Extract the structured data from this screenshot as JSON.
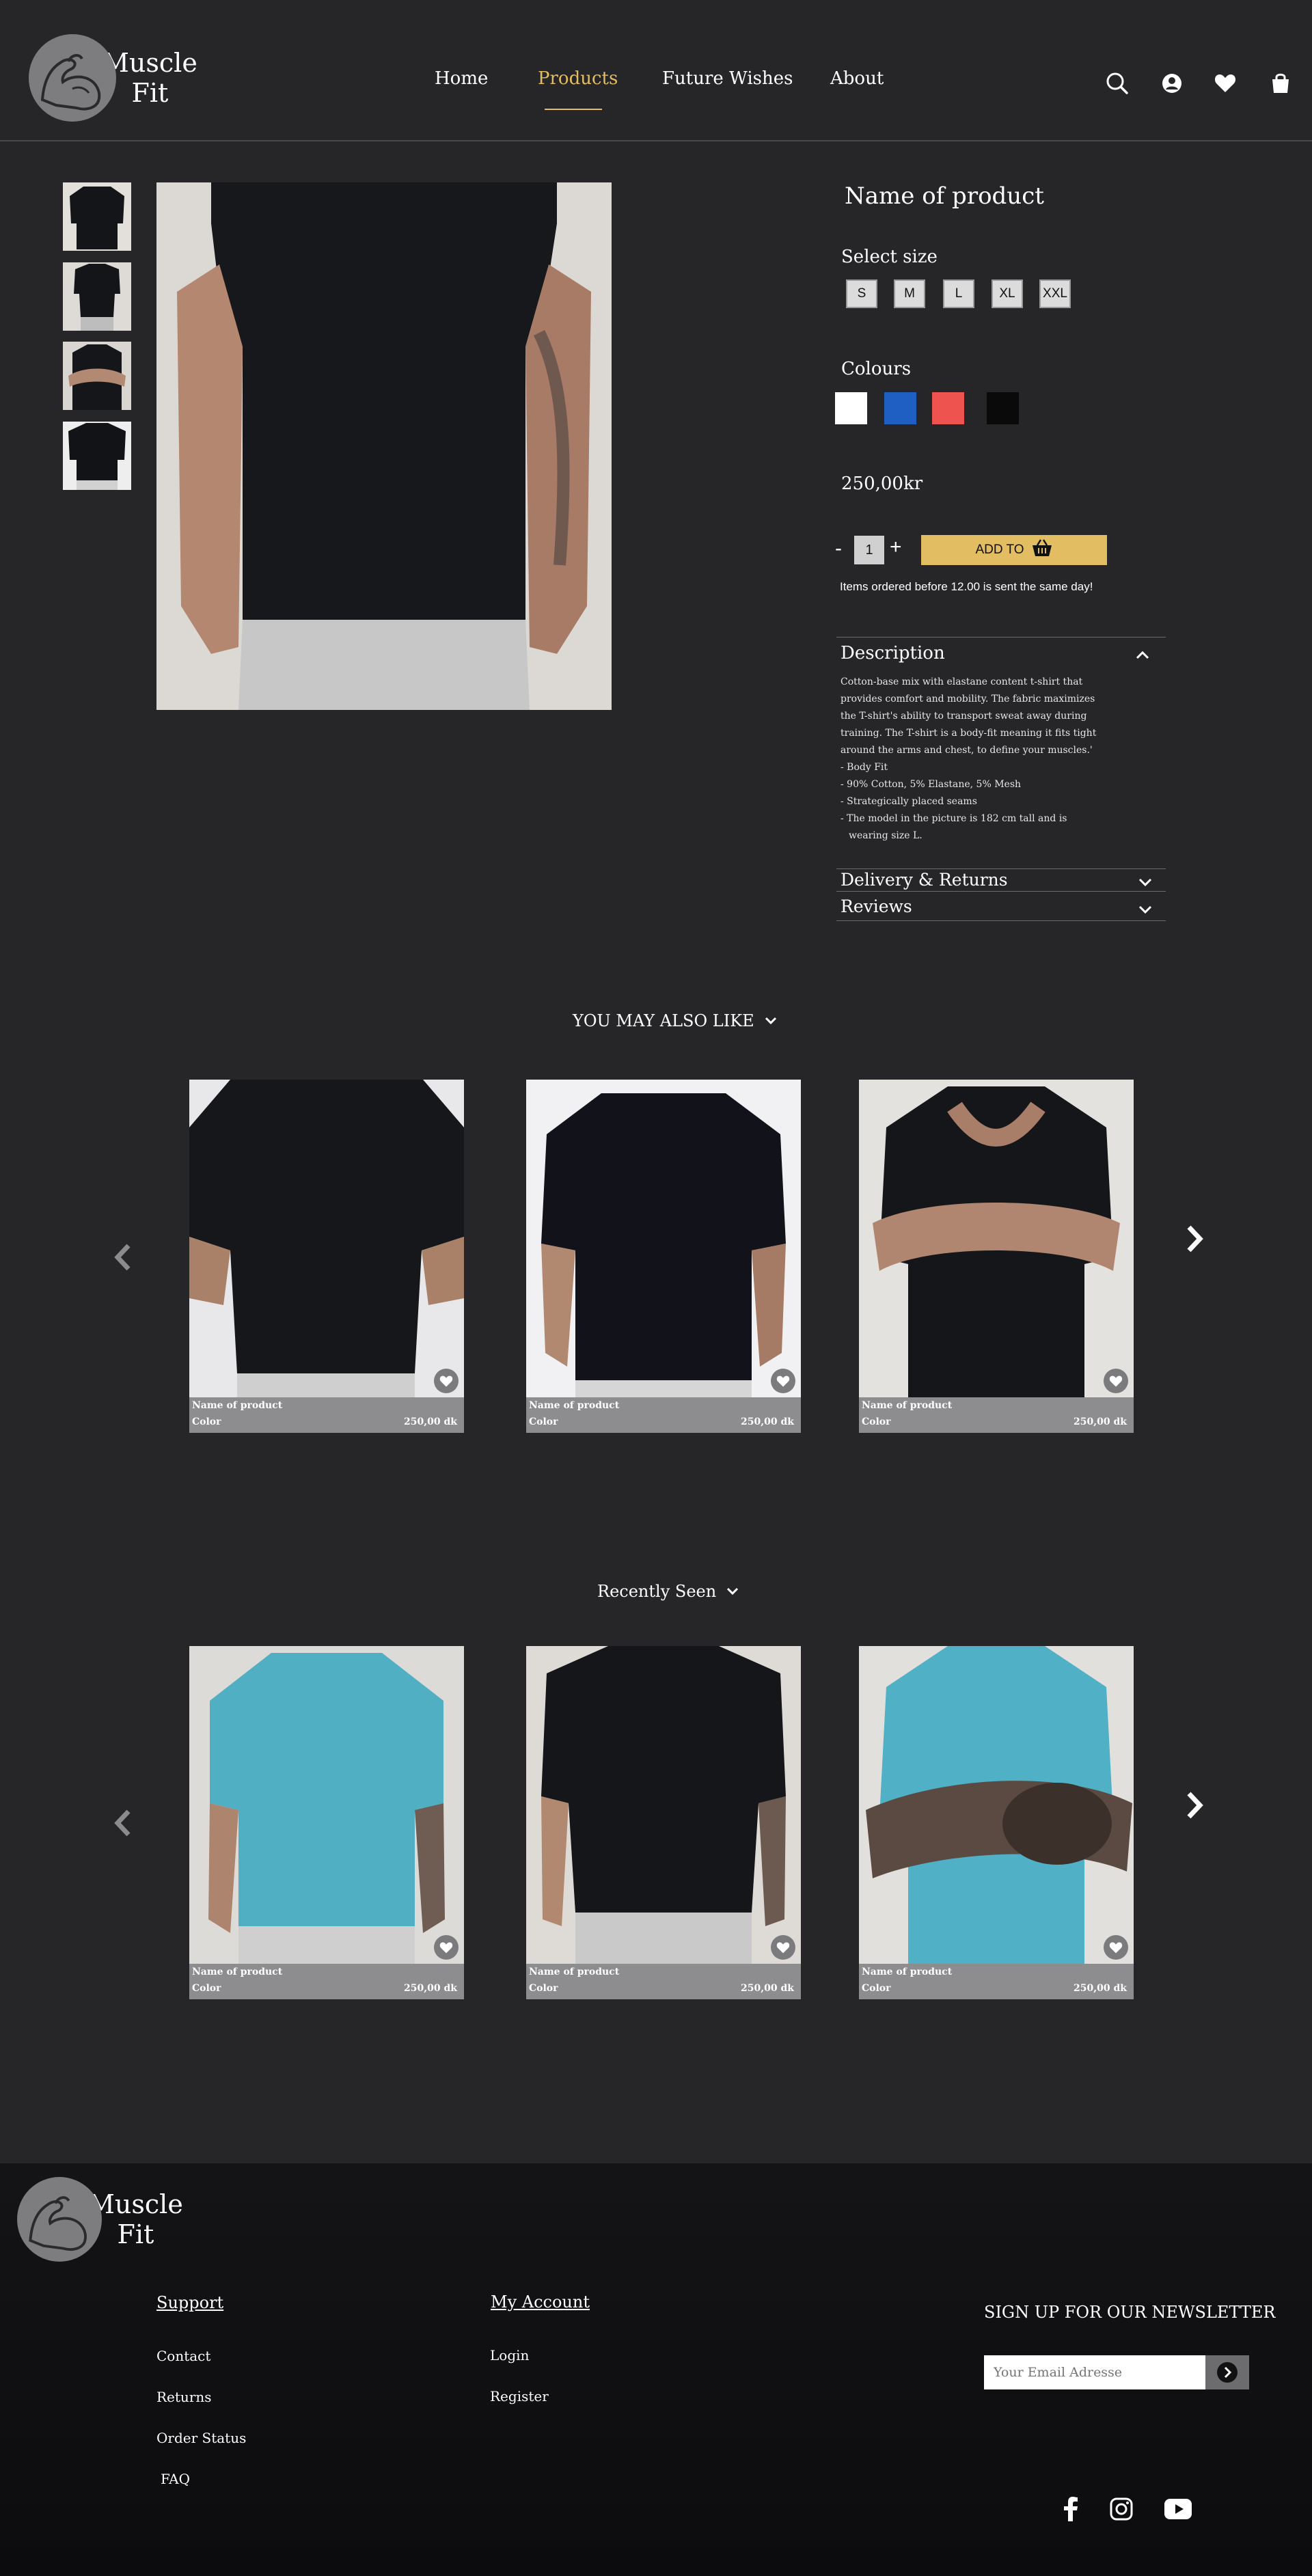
{
  "brand": {
    "line1": "Muscle",
    "line2": "Fit"
  },
  "nav": [
    {
      "label": "Home"
    },
    {
      "label": "Products"
    },
    {
      "label": "Future Wishes"
    },
    {
      "label": "About"
    }
  ],
  "header_icons": [
    "search-icon",
    "user-icon",
    "heart-icon",
    "shopping-bag-icon"
  ],
  "product": {
    "name": "Name of product",
    "size_label": "Select size",
    "sizes": [
      "S",
      "M",
      "L",
      "XL",
      "XXL"
    ],
    "colours_label": "Colours",
    "colours": [
      "#ffffff",
      "#1f5fc4",
      "#ef5350",
      "#0a0a0a"
    ],
    "price": "250,00kr",
    "quantity": "1",
    "minus": "-",
    "plus": "+",
    "add_to_cart": "ADD TO",
    "shipping_note": "Items ordered before 12.00 is sent the same day!",
    "description_title": "Description",
    "description_text": "Cotton-base mix with elastane content t-shirt that provides comfort and mobility. The fabric maximizes the T-shirt's ability to transport sweat away during training. The T-shirt is a body-fit meaning it fits tight around the arms and chest, to define your muscles.'",
    "description_bullets": [
      "- Body Fit",
      "- 90% Cotton, 5% Elastane, 5% Mesh",
      "- Strategically placed seams",
      "- The model in the picture is 182 cm tall and is",
      "wearing size L."
    ],
    "delivery_title": "Delivery & Returns",
    "reviews_title": "Reviews"
  },
  "also_like": {
    "title": "YOU MAY ALSO LIKE",
    "cards": [
      {
        "name": "Name of product",
        "color": "Color",
        "price": "250,00 dk"
      },
      {
        "name": "Name of product",
        "color": "Color",
        "price": "250,00 dk"
      },
      {
        "name": "Name of product",
        "color": "Color",
        "price": "250,00 dk"
      }
    ]
  },
  "recently_seen": {
    "title": "Recently Seen",
    "cards": [
      {
        "name": "Name of product",
        "color": "Color",
        "price": "250,00 dk"
      },
      {
        "name": "Name of product",
        "color": "Color",
        "price": "250,00 dk"
      },
      {
        "name": "Name of product",
        "color": "Color",
        "price": "250,00 dk"
      }
    ]
  },
  "footer": {
    "support_title": "Support",
    "support_links": [
      "Contact",
      "Returns",
      "Order Status",
      "FAQ"
    ],
    "account_title": "My Account",
    "account_links": [
      "Login",
      "Register"
    ],
    "newsletter_title": "SIGN UP FOR OUR NEWSLETTER",
    "email_placeholder": "Your Email Adresse",
    "social_icons": [
      "facebook-icon",
      "instagram-icon",
      "youtube-icon"
    ]
  },
  "colors": {
    "background": "#262628",
    "accent": "#e2bd61",
    "card_info": "#8d8d8f",
    "footer": "#0f0f11"
  }
}
